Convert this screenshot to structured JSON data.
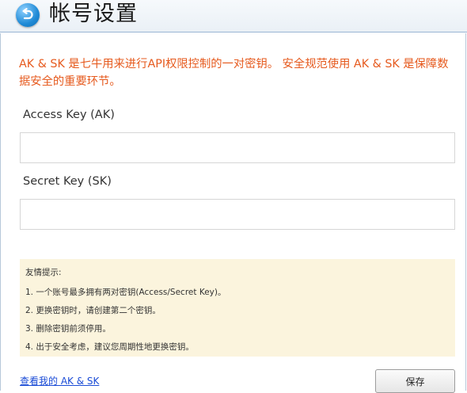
{
  "header": {
    "title": "帐号设置",
    "back_icon": "back-arrow-icon"
  },
  "notice": "AK & SK 是七牛用来进行API权限控制的一对密钥。 安全规范使用 AK & SK 是保障数据安全的重要环节。",
  "form": {
    "access_key_label": "Access Key (AK)",
    "access_key_value": "",
    "secret_key_label": "Secret Key (SK)",
    "secret_key_value": ""
  },
  "tips": {
    "title": "友情提示:",
    "items": [
      "1. 一个账号最多拥有两对密钥(Access/Secret Key)。",
      "2. 更换密钥时，请创建第二个密钥。",
      "3. 删除密钥前须停用。",
      "4. 出于安全考虑，建议您周期性地更换密钥。"
    ]
  },
  "footer": {
    "link_label": "查看我的 AK & SK",
    "save_label": "保存"
  },
  "colors": {
    "notice_text": "#e65a1e",
    "tips_background": "#fbf4dd",
    "link": "#1a4bd6",
    "back_button": "#1f8ad6"
  }
}
